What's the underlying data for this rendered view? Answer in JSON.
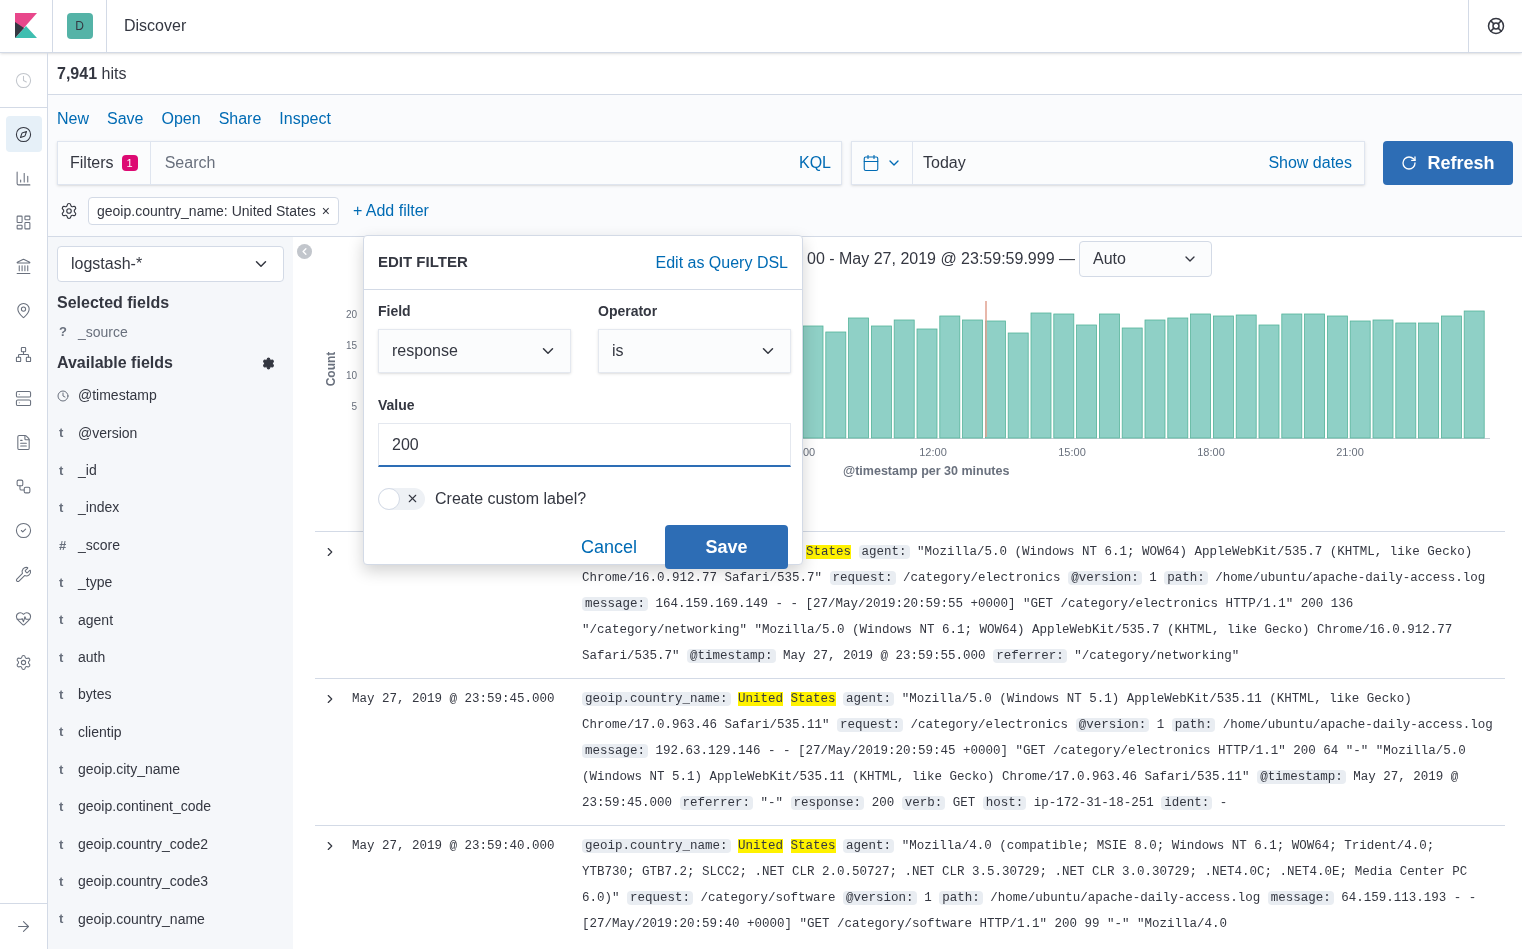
{
  "header": {
    "space_initial": "D",
    "title": "Discover"
  },
  "nav": [
    {
      "kind": "clock",
      "selected": false
    },
    {
      "kind": "compass",
      "selected": true
    },
    {
      "kind": "chart",
      "selected": false
    },
    {
      "kind": "dashboard",
      "selected": false
    },
    {
      "kind": "canvas",
      "selected": false
    },
    {
      "kind": "map",
      "selected": false
    },
    {
      "kind": "ml",
      "selected": false
    },
    {
      "kind": "server",
      "selected": false
    },
    {
      "kind": "logs",
      "selected": false
    },
    {
      "kind": "flow",
      "selected": false
    },
    {
      "kind": "uptime",
      "selected": false
    },
    {
      "kind": "wrench",
      "selected": false
    },
    {
      "kind": "heart",
      "selected": false
    },
    {
      "kind": "settings",
      "selected": false
    },
    {
      "kind": "expand",
      "selected": false
    }
  ],
  "hits": "**7,941** hits",
  "menu": [
    "New",
    "Save",
    "Open",
    "Share",
    "Inspect"
  ],
  "query_bar": {
    "filters_label": "Filters",
    "filters_count": "1",
    "placeholder": "Search",
    "language": "KQL",
    "date_value": "Today",
    "show_dates": "Show dates",
    "refresh": "Refresh"
  },
  "filters": [
    {
      "label": "geoip.country_name: United States",
      "remove": "×"
    }
  ],
  "add_filter": "+ Add filter",
  "index_pattern": "logstash-*",
  "selected_fields_title": "Selected fields",
  "selected_fields": [
    {
      "kind": "glyph",
      "glyph": "?",
      "name": "_source"
    }
  ],
  "available_fields_title": "Available fields",
  "available_fields": [
    {
      "kind": "date",
      "name": "@timestamp"
    },
    {
      "kind": "glyph",
      "glyph": "t",
      "name": "@version"
    },
    {
      "kind": "glyph",
      "glyph": "t",
      "name": "_id"
    },
    {
      "kind": "glyph",
      "glyph": "t",
      "name": "_index"
    },
    {
      "kind": "glyph",
      "glyph": "#",
      "name": "_score"
    },
    {
      "kind": "glyph",
      "glyph": "t",
      "name": "_type"
    },
    {
      "kind": "glyph",
      "glyph": "t",
      "name": "agent"
    },
    {
      "kind": "glyph",
      "glyph": "t",
      "name": "auth"
    },
    {
      "kind": "glyph",
      "glyph": "t",
      "name": "bytes"
    },
    {
      "kind": "glyph",
      "glyph": "t",
      "name": "clientip"
    },
    {
      "kind": "glyph",
      "glyph": "t",
      "name": "geoip.city_name"
    },
    {
      "kind": "glyph",
      "glyph": "t",
      "name": "geoip.continent_code"
    },
    {
      "kind": "glyph",
      "glyph": "t",
      "name": "geoip.country_code2"
    },
    {
      "kind": "glyph",
      "glyph": "t",
      "name": "geoip.country_code3"
    },
    {
      "kind": "glyph",
      "glyph": "t",
      "name": "geoip.country_name"
    }
  ],
  "histogram": {
    "range": "00 - May 27, 2019 @ 23:59:59.999 —",
    "interval": "Auto",
    "y_title": "Count",
    "y_ticks": [
      "20",
      "15",
      "10",
      "5"
    ],
    "x_ticks": [
      "00",
      "12:00",
      "15:00",
      "18:00",
      "21:00"
    ],
    "x_title": "@timestamp per 30 minutes"
  },
  "documents": [
    {
      "fields": [
        {
          "terms": [
            {
              "text": "States",
              "highlighted": true
            }
          ]
        },
        {
          "name": "agent:",
          "value": "\"Mozilla/5.0 (Windows NT 6.1; WOW64) AppleWebKit/535.7 (KHTML, like Gecko) Chrome/16.0.912.77 Safari/535.7\""
        },
        {
          "name": "request:",
          "value": "/category/electronics"
        },
        {
          "name": "@version:",
          "value": "1"
        },
        {
          "name": "path:",
          "value": "/home/ubuntu/apache-daily-access.log"
        },
        {
          "name": "message:",
          "value": "164.159.169.149 - - [27/May/2019:20:59:55 +0000] \"GET /category/electronics HTTP/1.1\" 200 136 \"/category/networking\" \"Mozilla/5.0 (Windows NT 6.1; WOW64) AppleWebKit/535.7 (KHTML, like Gecko) Chrome/16.0.912.77 Safari/535.7\""
        },
        {
          "name": "@timestamp:",
          "value": "May 27, 2019 @ 23:59:55.000"
        },
        {
          "name": "referrer:",
          "value": "\"/category/networking\""
        }
      ]
    },
    {
      "time": "May 27, 2019 @ 23:59:45.000",
      "fields": [
        {
          "name": "geoip.country_name:",
          "terms": [
            {
              "text": "United",
              "highlighted": true
            },
            {
              "text": "States",
              "highlighted": true
            }
          ]
        },
        {
          "name": "agent:",
          "value": "\"Mozilla/5.0 (Windows NT 5.1) AppleWebKit/535.11 (KHTML, like Gecko) Chrome/17.0.963.46 Safari/535.11\""
        },
        {
          "name": "request:",
          "value": "/category/electronics"
        },
        {
          "name": "@version:",
          "value": "1"
        },
        {
          "name": "path:",
          "value": "/home/ubuntu/apache-daily-access.log"
        },
        {
          "name": "message:",
          "value": "192.63.129.146 - - [27/May/2019:20:59:45 +0000] \"GET /category/electronics HTTP/1.1\" 200 64 \"-\" \"Mozilla/5.0 (Windows NT 5.1) AppleWebKit/535.11 (KHTML, like Gecko) Chrome/17.0.963.46 Safari/535.11\""
        },
        {
          "name": "@timestamp:",
          "value": "May 27, 2019 @ 23:59:45.000"
        },
        {
          "name": "referrer:",
          "value": "\"-\""
        },
        {
          "name": "response:",
          "value": "200"
        },
        {
          "name": "verb:",
          "value": "GET"
        },
        {
          "name": "host:",
          "value": "ip-172-31-18-251"
        },
        {
          "name": "ident:",
          "value": "-"
        }
      ]
    },
    {
      "time": "May 27, 2019 @ 23:59:40.000",
      "fields": [
        {
          "name": "geoip.country_name:",
          "terms": [
            {
              "text": "United",
              "highlighted": true
            },
            {
              "text": "States",
              "highlighted": true
            }
          ]
        },
        {
          "name": "agent:",
          "value": "\"Mozilla/4.0 (compatible; MSIE 8.0; Windows NT 6.1; WOW64; Trident/4.0; YTB730; GTB7.2; SLCC2; .NET CLR 2.0.50727; .NET CLR 3.5.30729; .NET CLR 3.0.30729; .NET4.0C; .NET4.0E; Media Center PC 6.0)\""
        },
        {
          "name": "request:",
          "value": "/category/software"
        },
        {
          "name": "@version:",
          "value": "1"
        },
        {
          "name": "path:",
          "value": "/home/ubuntu/apache-daily-access.log"
        },
        {
          "name": "message:",
          "value": "64.159.113.193 - - [27/May/2019:20:59:40 +0000] \"GET /category/software HTTP/1.1\" 200 99 \"-\" \"Mozilla/4.0"
        }
      ]
    }
  ],
  "edit_filter": {
    "title": "EDIT FILTER",
    "dsl_link": "Edit as Query DSL",
    "field_label": "Field",
    "field_value": "response",
    "operator_label": "Operator",
    "operator_value": "is",
    "value_label": "Value",
    "value": "200",
    "custom_label": {
      "label": "Create custom label?",
      "on": false
    },
    "cancel": "Cancel",
    "save": "Save"
  }
}
